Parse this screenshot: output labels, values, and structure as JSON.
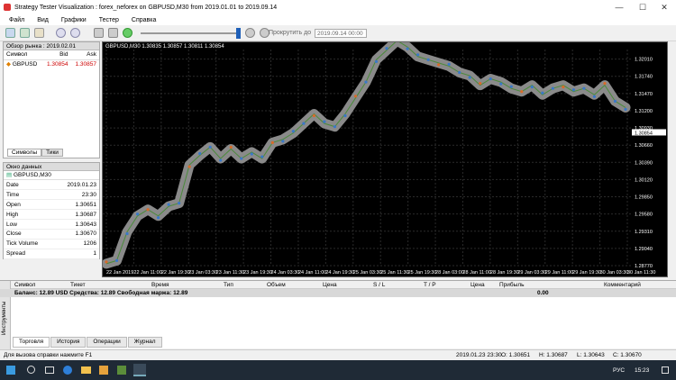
{
  "window": {
    "title": "Strategy Tester Visualization : forex_neforex on GBPUSD,M30 from 2019.01.01 to 2019.09.14"
  },
  "menu": [
    "Файл",
    "Вид",
    "Графики",
    "Тестер",
    "Справка"
  ],
  "toolbar": {
    "scroll_label": "Прокрутить до",
    "scroll_date": "2019.09.14 00:00"
  },
  "market_watch": {
    "title": "Обзор рынка : 2019.02.01",
    "columns": [
      "Символ",
      "Bid",
      "Ask"
    ],
    "rows": [
      {
        "symbol": "GBPUSD",
        "bid": "1.30854",
        "ask": "1.30857"
      }
    ],
    "tabs": [
      "Символы",
      "Тики"
    ]
  },
  "data_window": {
    "title": "Окно данных",
    "symbol": "GBPUSD,M30",
    "rows": [
      {
        "k": "Date",
        "v": "2019.01.23"
      },
      {
        "k": "Time",
        "v": "23:30"
      },
      {
        "k": "Open",
        "v": "1.30651"
      },
      {
        "k": "High",
        "v": "1.30687"
      },
      {
        "k": "Low",
        "v": "1.30643"
      },
      {
        "k": "Close",
        "v": "1.30670"
      },
      {
        "k": "Tick Volume",
        "v": "1206"
      },
      {
        "k": "Spread",
        "v": "1"
      }
    ]
  },
  "chart": {
    "header": "GBPUSD,M30  1.30835 1.30857 1.30811 1.30854",
    "price_labels": [
      "1.32010",
      "1.31740",
      "1.31470",
      "1.31200",
      "1.30930",
      "1.30854",
      "1.30660",
      "1.30390",
      "1.30120",
      "1.29850",
      "1.29580",
      "1.29310",
      "1.29040",
      "1.28770"
    ],
    "time_labels": [
      "22 Jan 2019",
      "22 Jan 11:00",
      "22 Jan 19:30",
      "23 Jan 03:30",
      "23 Jan 11:30",
      "23 Jan 19:30",
      "24 Jan 03:30",
      "24 Jan 11:00",
      "24 Jan 19:30",
      "25 Jan 03:30",
      "25 Jan 11:30",
      "25 Jan 19:30",
      "28 Jan 03:00",
      "28 Jan 11:00",
      "28 Jan 19:30",
      "29 Jan 03:30",
      "29 Jan 11:00",
      "29 Jan 19:30",
      "30 Jan 03:30",
      "30 Jan 11:30"
    ]
  },
  "terminal": {
    "columns": [
      "Символ",
      "Тикет",
      "Время",
      "Тип",
      "Объем",
      "Цена",
      "S / L",
      "T / P",
      "Цена",
      "Прибыль",
      "Комментарий"
    ],
    "balance": "Баланс: 12.89 USD  Средства: 12.89  Свободная маржа: 12.89",
    "profit": "0.00",
    "side_label": "Инструменты",
    "tabs": [
      "Торговля",
      "История",
      "Операции",
      "Журнал"
    ]
  },
  "status": {
    "help": "Для вызова справки нажмите F1",
    "datetime": "2019.01.23 23:30",
    "open": "O: 1.30651",
    "high": "H: 1.30687",
    "low": "L: 1.30643",
    "close": "C: 1.30670"
  },
  "taskbar": {
    "lang": "РУС",
    "time": "15:23"
  },
  "chart_data": {
    "type": "line",
    "x": [
      "22 Jan 2019",
      "22 Jan 11:00",
      "22 Jan 19:30",
      "23 Jan 03:30",
      "23 Jan 11:30",
      "23 Jan 19:30",
      "24 Jan 03:30",
      "24 Jan 11:00",
      "24 Jan 19:30",
      "25 Jan 03:30",
      "25 Jan 11:30",
      "25 Jan 19:30",
      "28 Jan 03:00",
      "28 Jan 11:00",
      "28 Jan 19:30",
      "29 Jan 03:30",
      "29 Jan 11:00",
      "29 Jan 19:30",
      "30 Jan 03:30",
      "30 Jan 11:30"
    ],
    "series": [
      {
        "values": [
          1.288,
          1.2885,
          1.293,
          1.2955,
          1.2965,
          1.2955,
          1.297,
          1.2975,
          1.3035,
          1.305,
          1.3063,
          1.3045,
          1.306,
          1.3045,
          1.3055,
          1.3045,
          1.307,
          1.3075,
          1.3085,
          1.31,
          1.3115,
          1.31,
          1.3095,
          1.3115,
          1.314,
          1.3165,
          1.32,
          1.3215,
          1.323,
          1.322,
          1.3205,
          1.32,
          1.3195,
          1.319,
          1.318,
          1.3175,
          1.316,
          1.317,
          1.3165,
          1.3155,
          1.315,
          1.316,
          1.3145,
          1.3155,
          1.316,
          1.315,
          1.3155,
          1.3145,
          1.316,
          1.3135,
          1.3125
        ]
      }
    ],
    "ylim": [
      1.2877,
      1.3216
    ],
    "grid": true
  }
}
